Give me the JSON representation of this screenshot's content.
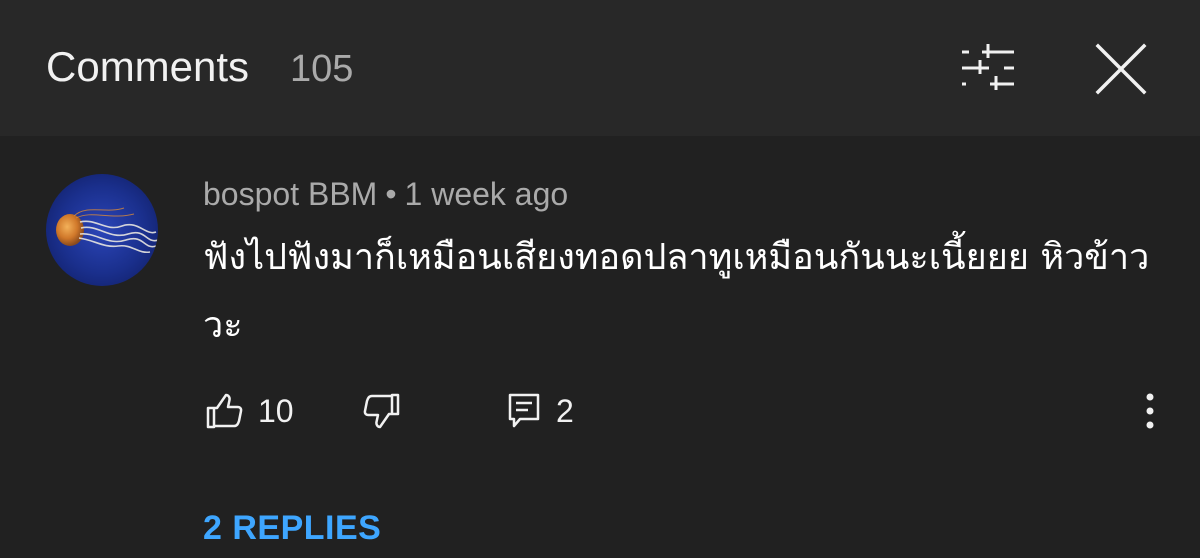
{
  "header": {
    "title": "Comments",
    "count": "105"
  },
  "comment": {
    "author": "bospot BBM",
    "separator": "•",
    "time": "1 week ago",
    "text": "ฟังไปฟังมาก็เหมือนเสียงทอดปลาทูเหมือนกันนะเนี้ยยย  หิวข้าววะ",
    "likes": "10",
    "replies_count": "2",
    "replies_link": "2 REPLIES"
  },
  "icons": {
    "filter": "filter-sliders-icon",
    "close": "close-icon",
    "like": "thumbs-up-icon",
    "dislike": "thumbs-down-icon",
    "reply": "comment-icon",
    "more": "more-vertical-icon"
  },
  "colors": {
    "background": "#212121",
    "header_background": "#282828",
    "link": "#3ea6ff",
    "secondary_text": "#aaaaaa"
  }
}
